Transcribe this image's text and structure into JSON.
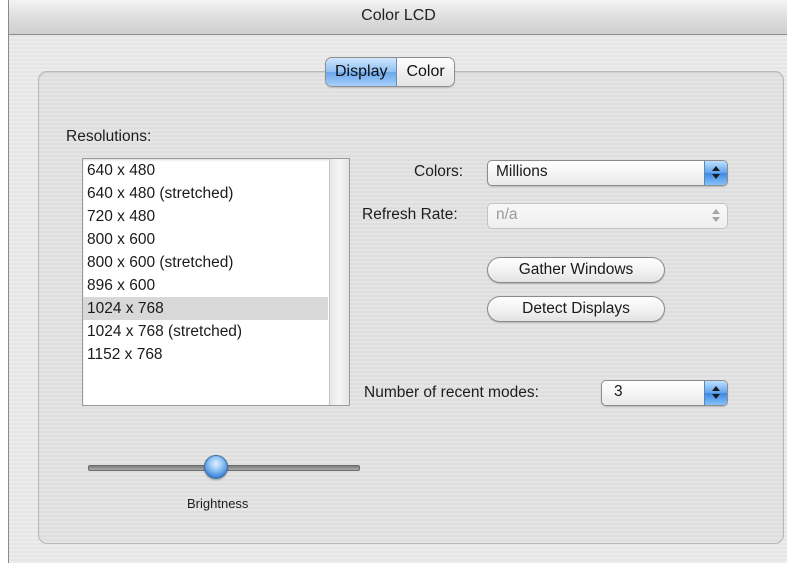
{
  "window": {
    "title": "Color LCD"
  },
  "tabs": [
    {
      "label": "Display",
      "selected": true
    },
    {
      "label": "Color",
      "selected": false
    }
  ],
  "resolutions": {
    "label": "Resolutions:",
    "items": [
      {
        "label": "640 x 480"
      },
      {
        "label": "640 x 480 (stretched)"
      },
      {
        "label": "720 x 480"
      },
      {
        "label": "800 x 600"
      },
      {
        "label": "800 x 600 (stretched)"
      },
      {
        "label": "896 x 600"
      },
      {
        "label": "1024 x 768",
        "selected": true
      },
      {
        "label": "1024 x 768 (stretched)"
      },
      {
        "label": "1152 x 768"
      }
    ]
  },
  "colors": {
    "label": "Colors:",
    "value": "Millions"
  },
  "refresh_rate": {
    "label": "Refresh Rate:",
    "value": "n/a",
    "enabled": false
  },
  "buttons": {
    "gather_windows": "Gather Windows",
    "detect_displays": "Detect Displays"
  },
  "recent_modes": {
    "label": "Number of recent modes:",
    "value": "3"
  },
  "brightness": {
    "label": "Brightness",
    "level_fraction": 0.45
  },
  "accent_color": "#5fa3ec"
}
